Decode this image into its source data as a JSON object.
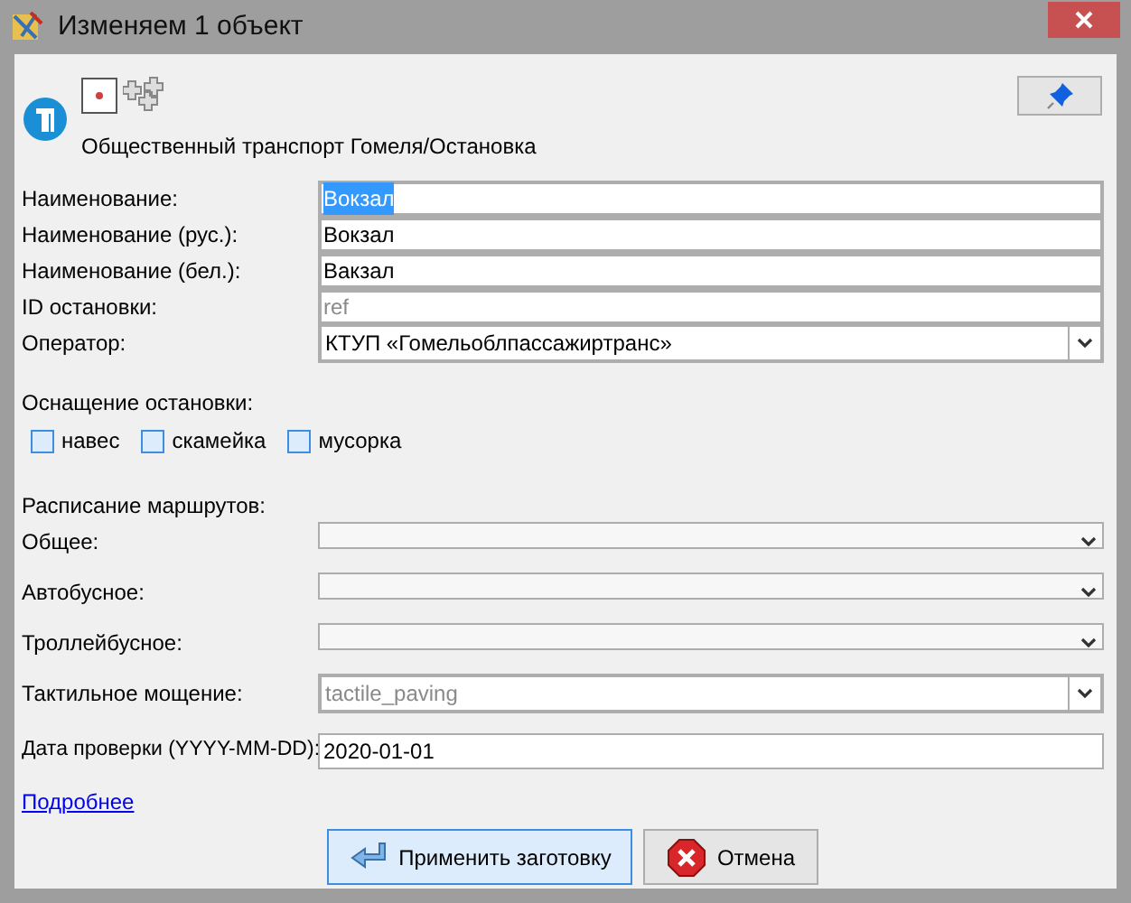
{
  "window": {
    "title": "Изменяем 1 объект"
  },
  "preset": {
    "path": "Общественный транспорт Гомеля/Остановка"
  },
  "fields": [
    {
      "kind": "text",
      "label": "Наименование:",
      "value": "Вокзал",
      "highlighted": true
    },
    {
      "kind": "text",
      "label": "Наименование (рус.):",
      "value": "Вокзал",
      "highlighted": false
    },
    {
      "kind": "text",
      "label": "Наименование (бел.):",
      "value": "Вакзал",
      "highlighted": false
    },
    {
      "kind": "text",
      "label": "ID остановки:",
      "placeholder": "ref",
      "highlighted": false
    },
    {
      "kind": "combo",
      "label": "Оператор:",
      "value": "КТУП «Гомельоблпассажиртранс»",
      "highlighted": false
    }
  ],
  "equipment": {
    "heading": "Оснащение остановки:",
    "options": [
      {
        "label": "навес",
        "checked": false
      },
      {
        "label": "скамейка",
        "checked": false
      },
      {
        "label": "мусорка",
        "checked": false
      }
    ]
  },
  "schedule": {
    "heading": "Расписание маршрутов:",
    "rows": [
      {
        "label": "Общее:"
      },
      {
        "label": "Автобусное:"
      },
      {
        "label": "Троллейбусное:"
      }
    ]
  },
  "tactile": {
    "label": "Тактильное мощение:",
    "placeholder": "tactile_paving"
  },
  "check_date": {
    "label": "Дата проверки (YYYY-MM-DD):",
    "value": "2020-01-01"
  },
  "more_link": "Подробнее",
  "buttons": [
    {
      "kind": "apply",
      "label": "Применить заготовку"
    },
    {
      "kind": "cancel",
      "label": "Отмена"
    }
  ]
}
